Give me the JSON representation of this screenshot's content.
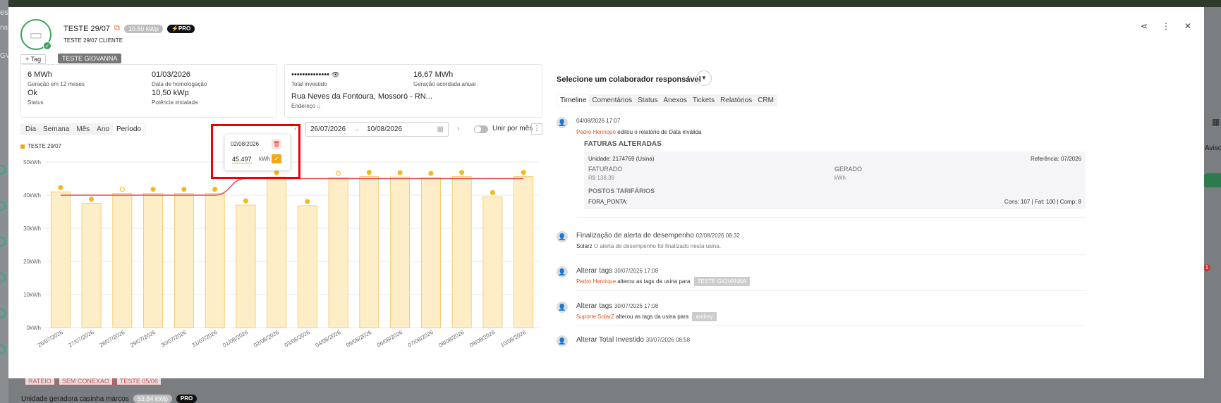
{
  "background": {
    "frag_es": "es",
    "frag_na": "na",
    "frag_gv": "GV",
    "frag_aviso": "Aviso",
    "bottom_badges": [
      "RATEIO",
      "SEM CONEXAO",
      "TESTE 05/06"
    ],
    "bottom_plant_name": "Unidade geradora casinha marcos",
    "bottom_plant_kwp": "53.84 kWp",
    "bottom_plant_pro": "PRO",
    "notif_count": "1"
  },
  "header": {
    "plant_name": "TESTE 29/07",
    "kwp": "10.50 kWp",
    "pro_label": "PRO",
    "client": "TESTE 29/07 CLIENTE",
    "tag_button": "Tag",
    "tag_chip": "TESTE GIOVANNA"
  },
  "card1": {
    "gen_value": "6 MWh",
    "gen_label": "Geração em 12 meses",
    "homolog_value": "01/03/2026",
    "homolog_label": "Data de homologação",
    "status_value": "Ok",
    "status_label": "Status",
    "power_value": "10,50 kWp",
    "power_label": "Potência instalada"
  },
  "card2": {
    "invest_value": "••••••••••••••",
    "invest_label": "Total investido",
    "annual_value": "16,67 MWh",
    "annual_label": "Geração acordada anual",
    "address_value": "Rua Neves da Fontoura, Mossoró - RN...",
    "address_label": "Endereço"
  },
  "chart_controls": {
    "tabs": [
      "Dia",
      "Semana",
      "Mês",
      "Ano",
      "Período"
    ],
    "active_tab": "Período",
    "date_start": "26/07/2026",
    "date_end": "10/08/2026",
    "toggle_label": "Unir por mês"
  },
  "tooltip": {
    "date": "02/08/2026",
    "value": "45.497",
    "unit": "kWh"
  },
  "chart_data": {
    "type": "bar",
    "legend": "TESTE 29/07",
    "categories": [
      "26/07/2026",
      "27/07/2026",
      "28/07/2026",
      "29/07/2026",
      "30/07/2026",
      "31/07/2026",
      "01/08/2026",
      "02/08/2026",
      "03/08/2026",
      "04/08/2026",
      "05/08/2026",
      "06/08/2026",
      "07/08/2026",
      "08/08/2026",
      "09/08/2026",
      "10/08/2026"
    ],
    "values": [
      41000,
      37500,
      40500,
      40500,
      40500,
      40500,
      37000,
      45500,
      36800,
      45300,
      45600,
      45500,
      45300,
      45600,
      39500,
      45600
    ],
    "weather": [
      "sun",
      "sun",
      "partly",
      "sun",
      "sun",
      "sun",
      "sun",
      "sun",
      "sun",
      "partly",
      "sun",
      "sun",
      "sun",
      "sun",
      "sun",
      "sun"
    ],
    "target_line": [
      40000,
      40000,
      40000,
      40000,
      40000,
      40000,
      45000,
      45000,
      45000,
      45000,
      45000,
      45000,
      45000,
      45000,
      45000,
      45000
    ],
    "yticks": [
      "0kWh",
      "10kWh",
      "20kWh",
      "30kWh",
      "40kWh",
      "50kWh"
    ],
    "ylim": [
      0,
      50000
    ],
    "bar_color": "#fdeec8",
    "bar_border": "#f3c25a",
    "line_color": "#e84a4a"
  },
  "right": {
    "responsible_label": "Selecione um colaborador responsável",
    "tabs": [
      "Timeline",
      "Comentários",
      "Status",
      "Anexos",
      "Tickets",
      "Relatórios",
      "CRM"
    ],
    "active_tab": "Timeline",
    "events": [
      {
        "date": "04/08/2026 17:07",
        "who": "Pedro Henrique",
        "text": "editou o relatório de Data inválida",
        "fat_title": "FATURAS ALTERADAS",
        "unit": "Unidade: 2174769 (Usina)",
        "ref": "Referência: 07/2026",
        "faturado_label": "FATURADO",
        "faturado_value": "R$ 138,39",
        "gerado_label": "GERADO",
        "gerado_value": "kWh",
        "postos_label": "POSTOS TARIFÁRIOS",
        "fora_ponta": "FORA_PONTA:",
        "cons": "Cons: 107 | Fat: 100 | Comp: 8"
      },
      {
        "title": "Finalização de alerta de desempenho",
        "date": "02/08/2026 08:32",
        "who": "Solarz",
        "text": "O alerta de desempenho foi finalizado nesta usina."
      },
      {
        "title": "Alterar tags",
        "date": "30/07/2026 17:08",
        "who": "Pedro Henrique",
        "text": "alterou as tags da usina para",
        "pill": "TESTE GIOVANNA"
      },
      {
        "title": "Alterar tags",
        "date": "30/07/2026 17:08",
        "who": "Suporte SolarZ",
        "text": "alterou as tags da usina para",
        "pill": "andrey"
      },
      {
        "title": "Alterar Total Investido",
        "date": "30/07/2026 08:58"
      }
    ]
  }
}
